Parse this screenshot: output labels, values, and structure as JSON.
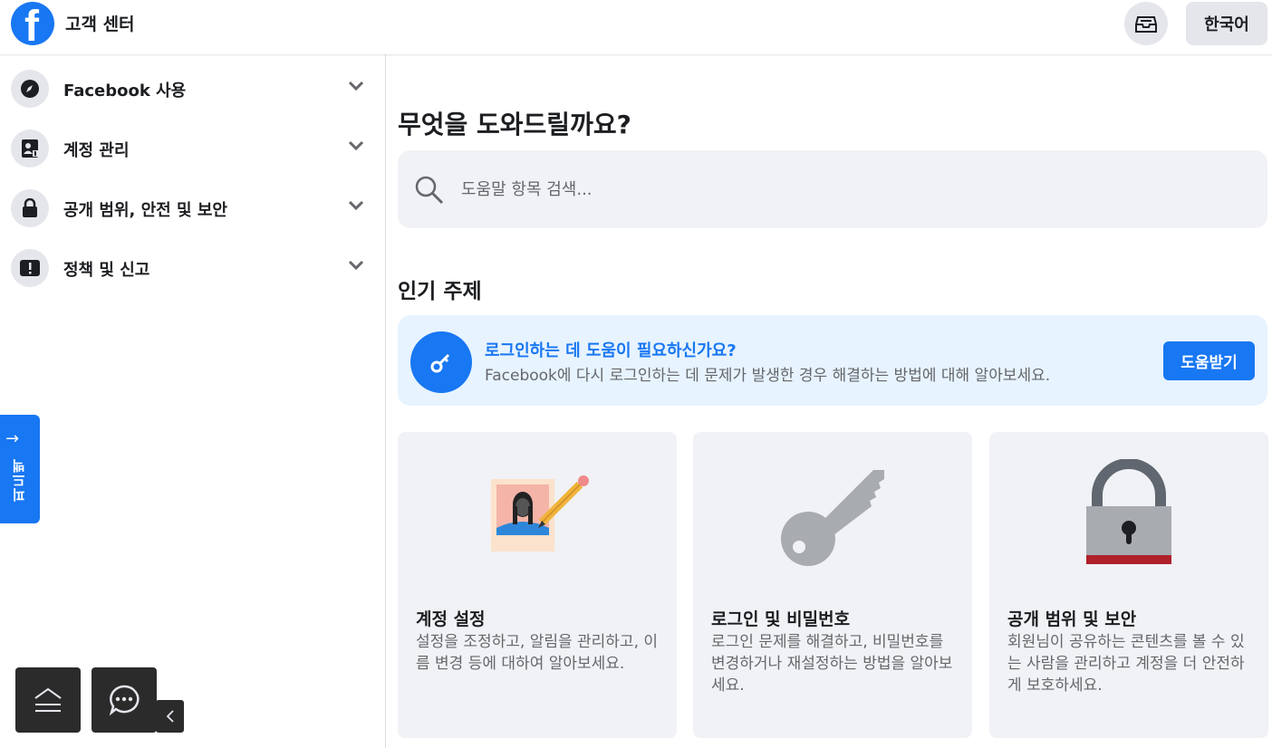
{
  "header": {
    "logo_letter": "f",
    "title": "고객 센터",
    "inbox_icon": "inbox-icon",
    "language_label": "한국어"
  },
  "sidebar": {
    "items": [
      {
        "label": "Facebook 사용",
        "icon": "compass-icon"
      },
      {
        "label": "계정 관리",
        "icon": "profile-card-icon"
      },
      {
        "label": "공개 범위, 안전 및 보안",
        "icon": "lock-icon"
      },
      {
        "label": "정책 및 신고",
        "icon": "alert-icon"
      }
    ]
  },
  "feedback": {
    "label": "피드백"
  },
  "main": {
    "title": "무엇을 도와드릴까요?",
    "search": {
      "placeholder": "도움말 항목 검색..."
    },
    "popular_title": "인기 주제",
    "banner": {
      "title": "로그인하는 데 도움이 필요하신가요?",
      "description": "Facebook에 다시 로그인하는 데 문제가 발생한 경우 해결하는 방법에 대해 알아보세요.",
      "button": "도움받기"
    },
    "cards": [
      {
        "title": "계정 설정",
        "description": "설정을 조정하고, 알림을 관리하고, 이름 변경 등에 대하여 알아보세요.",
        "illustration": "profile-photo-pencil-icon"
      },
      {
        "title": "로그인 및 비밀번호",
        "description": "로그인 문제를 해결하고, 비밀번호를 변경하거나 재설정하는 방법을 알아보세요.",
        "illustration": "key-icon"
      },
      {
        "title": "공개 범위 및 보안",
        "description": "회원님이 공유하는 콘텐츠를 볼 수 있는 사람을 관리하고 계정을 더 안전하게 보호하세요.",
        "illustration": "padlock-icon"
      }
    ]
  },
  "colors": {
    "accent": "#1877f2",
    "banner_bg": "#e7f3ff",
    "card_bg": "#f0f2f5",
    "lock_stripe": "#b0202a"
  }
}
